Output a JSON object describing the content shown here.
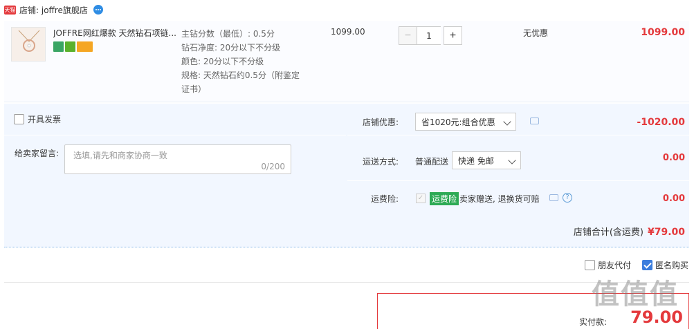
{
  "shop": {
    "badge": "天猫",
    "label": "店铺: joffre旗舰店"
  },
  "item": {
    "title": "JOFFRE网红爆款 天然钻石项链...",
    "props": [
      "主钻分数（最低）: 0.5分",
      "钻石净度: 20分以下不分级",
      "颜色: 20分以下不分级",
      "规格: 天然钻石约0.5分（附鉴定",
      "证书）"
    ],
    "unit_price": "1099.00",
    "quantity": "1",
    "discount": "无优惠",
    "total": "1099.00"
  },
  "invoice": {
    "label": "开具发票"
  },
  "message": {
    "label": "给卖家留言:",
    "placeholder": "选填,请先和商家协商一致",
    "counter": "0/200"
  },
  "shop_discount": {
    "label": "店铺优惠:",
    "selected": "省1020元:组合优惠",
    "amount": "-1020.00"
  },
  "shipping": {
    "label": "运送方式:",
    "type": "普通配送",
    "selected": "快递 免邮",
    "amount": "0.00"
  },
  "insurance": {
    "label": "运费险:",
    "tag": "运费险",
    "text": "卖家赠送, 退换货可赔",
    "amount": "0.00"
  },
  "shop_total": {
    "label": "店铺合计(含运费)",
    "amount": "¥79.00"
  },
  "options": {
    "friend_pay": "朋友代付",
    "anonymous": "匿名购买"
  },
  "payment": {
    "label": "实付款:",
    "amount": "79.00"
  },
  "watermark": "值值值"
}
